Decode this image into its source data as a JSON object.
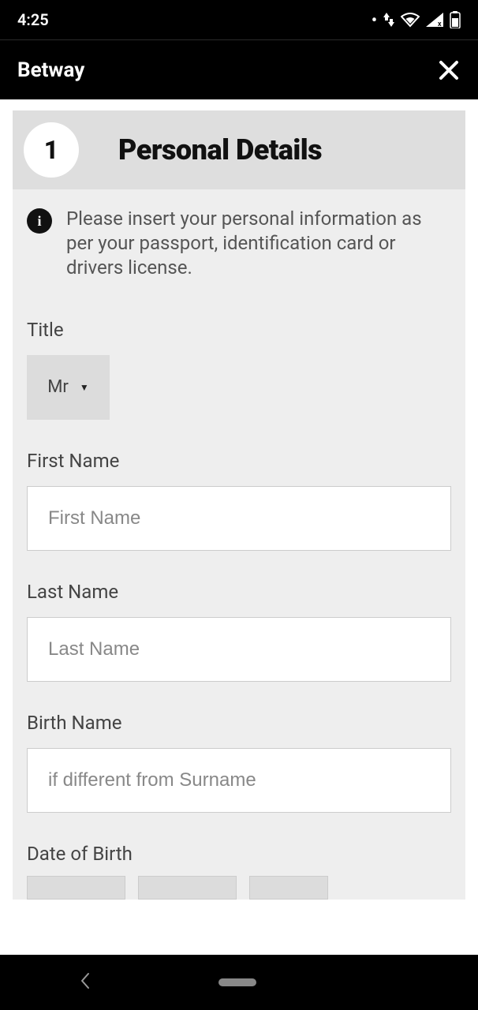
{
  "status": {
    "time": "4:25"
  },
  "header": {
    "title": "Betway"
  },
  "step": {
    "number": "1",
    "title": "Personal Details"
  },
  "info": {
    "text": "Please insert your personal information as per your passport, identification card or drivers license."
  },
  "form": {
    "title": {
      "label": "Title",
      "selected": "Mr"
    },
    "first_name": {
      "label": "First Name",
      "placeholder": "First Name",
      "value": ""
    },
    "last_name": {
      "label": "Last Name",
      "placeholder": "Last Name",
      "value": ""
    },
    "birth_name": {
      "label": "Birth Name",
      "placeholder": "if different from Surname",
      "value": ""
    },
    "dob": {
      "label": "Date of Birth"
    }
  }
}
